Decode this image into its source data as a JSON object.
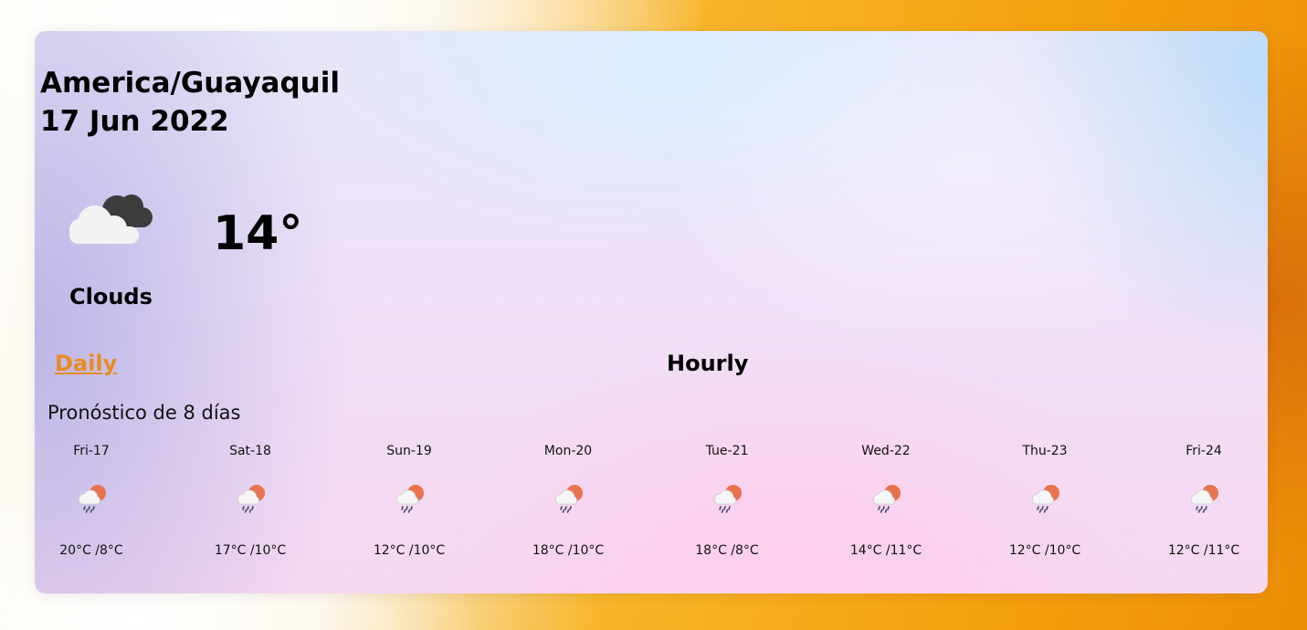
{
  "header": {
    "location": "America/Guayaquil",
    "date": "17 Jun 2022"
  },
  "current": {
    "icon": "clouds-icon",
    "temperature": "14°",
    "condition": "Clouds"
  },
  "tabs": {
    "daily_label": "Daily",
    "hourly_label": "Hourly",
    "active": "Daily",
    "active_color": "#e88c1f"
  },
  "forecast": {
    "title": "Pronóstico de 8 días",
    "days": [
      {
        "day": "Fri-17",
        "temps": "20°C /8°C",
        "icon": "rain-sun-icon"
      },
      {
        "day": "Sat-18",
        "temps": "17°C /10°C",
        "icon": "rain-sun-icon"
      },
      {
        "day": "Sun-19",
        "temps": "12°C /10°C",
        "icon": "rain-sun-icon"
      },
      {
        "day": "Mon-20",
        "temps": "18°C /10°C",
        "icon": "rain-sun-icon"
      },
      {
        "day": "Tue-21",
        "temps": "18°C /8°C",
        "icon": "rain-sun-icon"
      },
      {
        "day": "Wed-22",
        "temps": "14°C /11°C",
        "icon": "rain-sun-icon"
      },
      {
        "day": "Thu-23",
        "temps": "12°C /10°C",
        "icon": "rain-sun-icon"
      },
      {
        "day": "Fri-24",
        "temps": "12°C /11°C",
        "icon": "rain-sun-icon"
      }
    ]
  }
}
